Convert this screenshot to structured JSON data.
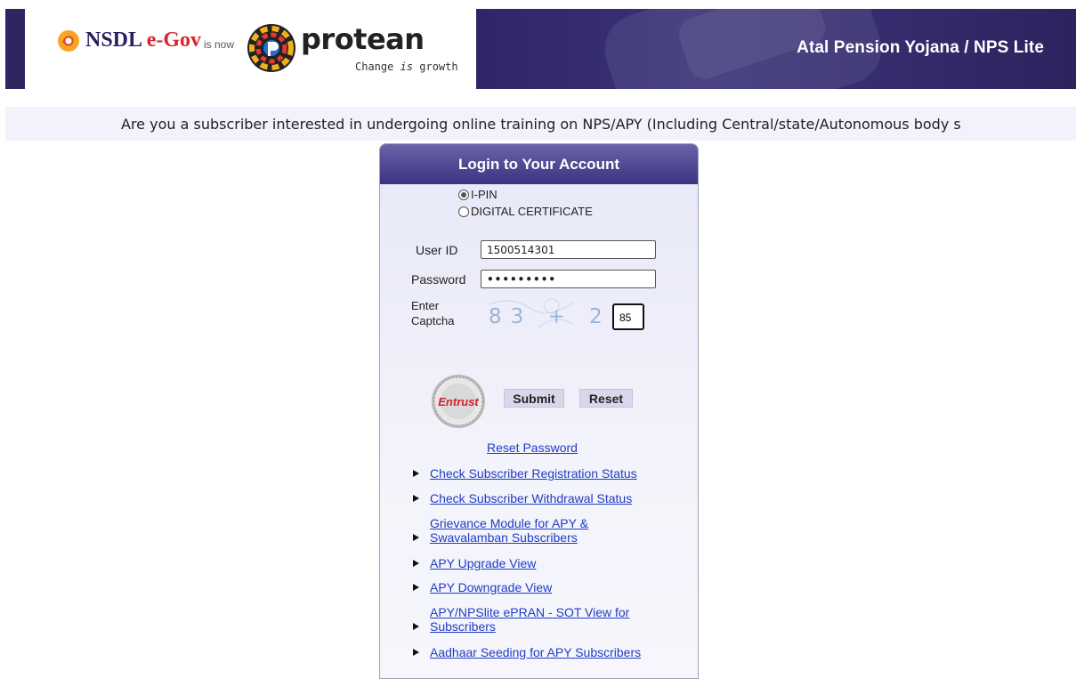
{
  "header": {
    "nsdl_brand": "NSDL",
    "nsdl_brand_suffix": "e-Gov",
    "is_now": "is now",
    "protean_name": "protean",
    "protean_tagline_pre": "Change ",
    "protean_tagline_em": "is",
    "protean_tagline_post": " growth",
    "title": "Atal Pension Yojana / NPS Lite",
    "colors": {
      "primary": "#2e2563",
      "accent_red": "#d8262c"
    }
  },
  "banner": {
    "text": "Are you a subscriber interested in undergoing online training on NPS/APY (Including Central/state/Autonomous body s"
  },
  "login": {
    "title": "Login to Your Account",
    "radio_options": [
      {
        "label": "I-PIN",
        "checked": true
      },
      {
        "label": "DIGITAL CERTIFICATE",
        "checked": false
      }
    ],
    "user_id_label": "User ID",
    "user_id_value": "1500514301",
    "password_label": "Password",
    "password_value": "•••••••••",
    "captcha_label_1": "Enter",
    "captcha_label_2": "Captcha",
    "captcha_text": "83 + 2 =",
    "captcha_answer": "85",
    "entrust_text": "Entrust",
    "submit_label": "Submit",
    "reset_label": "Reset",
    "reset_password_label": "Reset Password",
    "links": [
      "Check Subscriber Registration Status",
      "Check Subscriber Withdrawal Status",
      "Grievance Module for APY & Swavalamban Subscribers",
      "APY Upgrade View",
      "APY Downgrade View",
      "APY/NPSlite ePRAN - SOT View for Subscribers",
      "Aadhaar Seeding for APY Subscribers"
    ]
  }
}
